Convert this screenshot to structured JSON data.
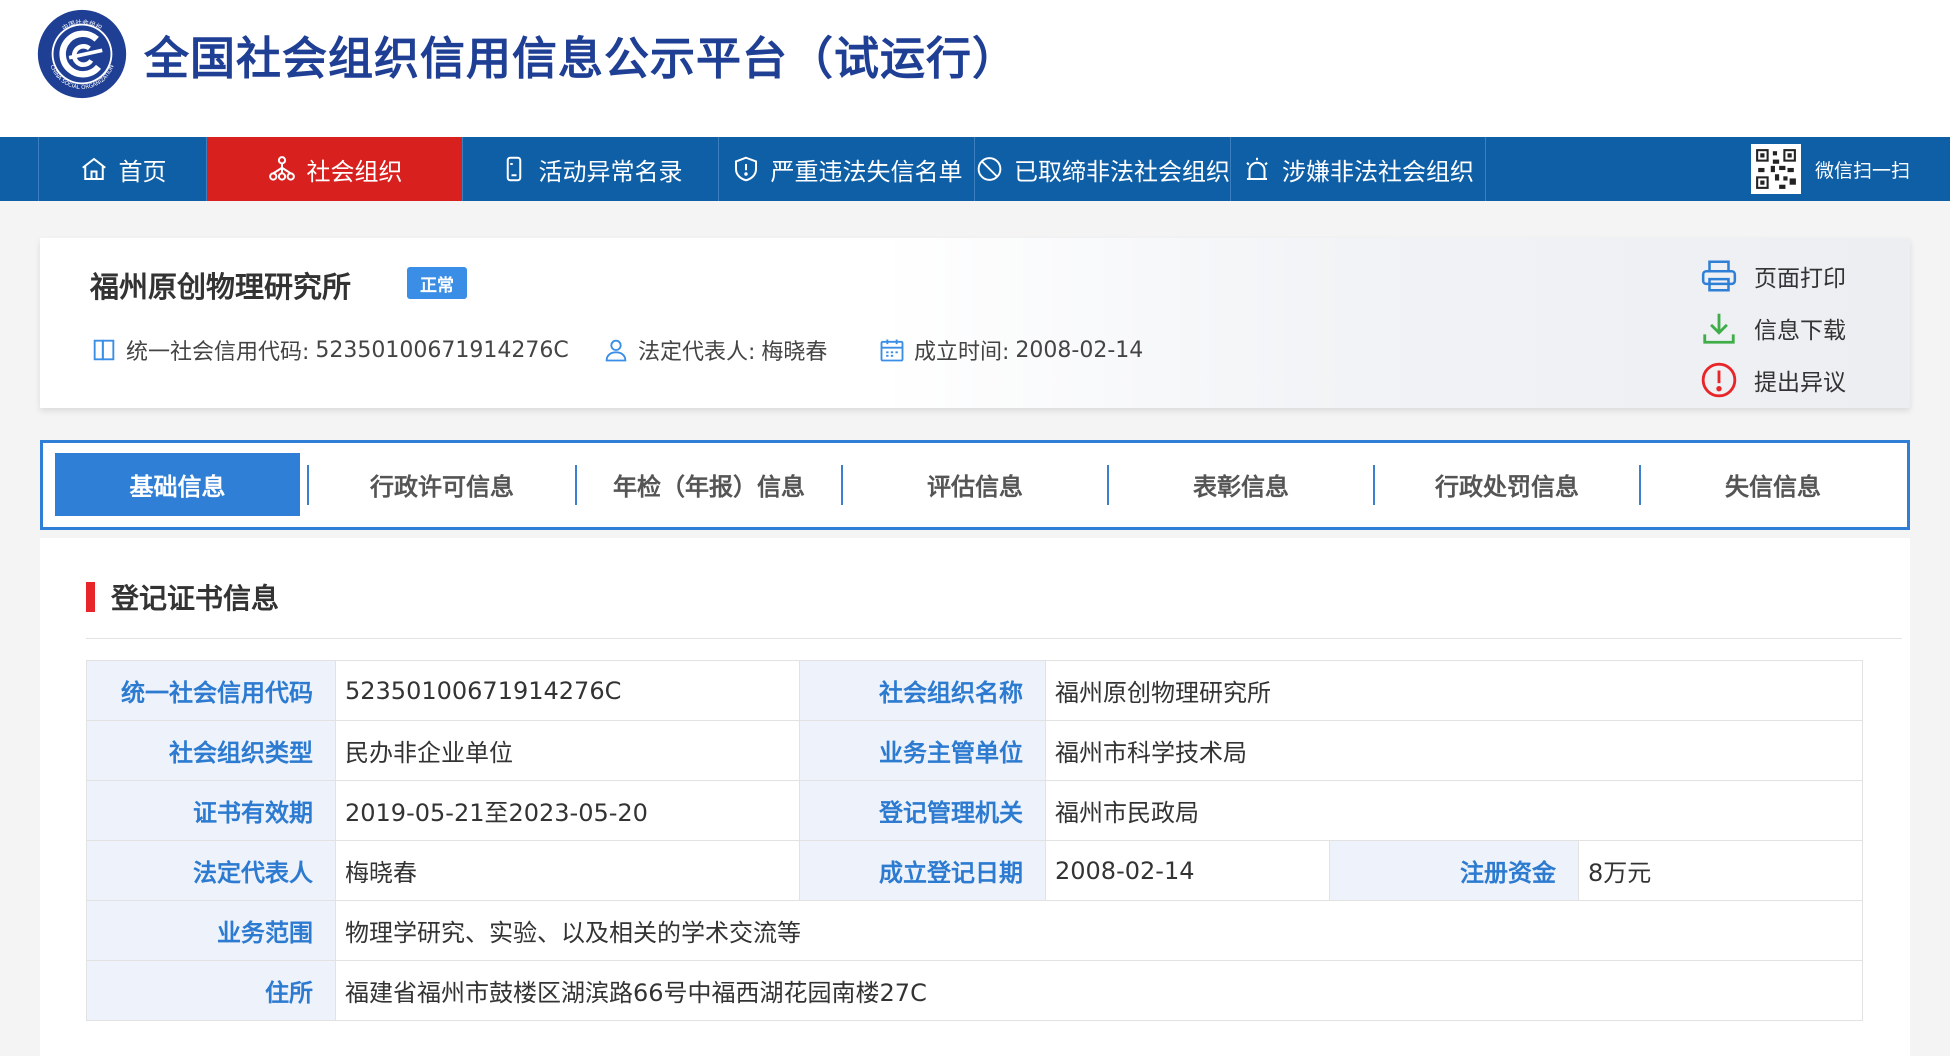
{
  "header": {
    "title": "全国社会组织信用信息公示平台（试运行）",
    "logo_text": "CHINA SOCIAL ORGANIZATION",
    "logo_top_text": "中国社会组织"
  },
  "nav": {
    "items": [
      {
        "label": "首页",
        "icon": "home-icon"
      },
      {
        "label": "社会组织",
        "icon": "org-icon",
        "active": true
      },
      {
        "label": "活动异常名录",
        "icon": "phone-icon"
      },
      {
        "label": "严重违法失信名单",
        "icon": "shield-icon"
      },
      {
        "label": "已取缔非法社会组织",
        "icon": "ban-icon"
      },
      {
        "label": "涉嫌非法社会组织",
        "icon": "alarm-icon"
      }
    ],
    "wechat_label": "微信扫一扫"
  },
  "org": {
    "name": "福州原创物理研究所",
    "status": "正常",
    "credit_code_label": "统一社会信用代码:",
    "credit_code": "52350100671914276C",
    "legal_rep_label": "法定代表人:",
    "legal_rep": "梅晓春",
    "founded_label": "成立时间:",
    "founded": "2008-02-14"
  },
  "actions": {
    "print": "页面打印",
    "download": "信息下载",
    "objection": "提出异议"
  },
  "tabs": [
    "基础信息",
    "行政许可信息",
    "年检（年报）信息",
    "评估信息",
    "表彰信息",
    "行政处罚信息",
    "失信信息"
  ],
  "section": {
    "title": "登记证书信息"
  },
  "table": {
    "credit_code_label": "统一社会信用代码",
    "credit_code": "52350100671914276C",
    "org_name_label": "社会组织名称",
    "org_name": "福州原创物理研究所",
    "org_type_label": "社会组织类型",
    "org_type": "民办非企业单位",
    "supervisor_label": "业务主管单位",
    "supervisor": "福州市科学技术局",
    "validity_label": "证书有效期",
    "validity": "2019-05-21至2023-05-20",
    "registrar_label": "登记管理机关",
    "registrar": "福州市民政局",
    "legal_rep_label": "法定代表人",
    "legal_rep": "梅晓春",
    "reg_date_label": "成立登记日期",
    "reg_date": "2008-02-14",
    "capital_label": "注册资金",
    "capital": "8万元",
    "scope_label": "业务范围",
    "scope": "物理学研究、实验、以及相关的学术交流等",
    "address_label": "住所",
    "address": "福建省福州市鼓楼区湖滨路66号中福西湖花园南楼27C"
  },
  "colors": {
    "brand_blue": "#1f3f95",
    "nav_blue": "#0f5fa7",
    "nav_active": "#d8201e",
    "accent_blue": "#2f7fd6",
    "section_bar": "#e8262a"
  }
}
